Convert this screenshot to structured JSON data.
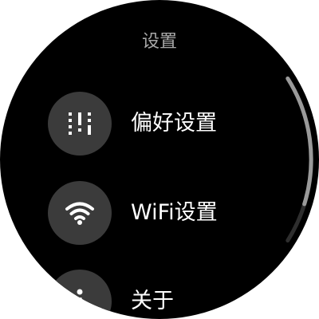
{
  "screen": {
    "title": "设置"
  },
  "menu": {
    "items": [
      {
        "label": "偏好设置",
        "icon": "preferences-icon"
      },
      {
        "label": "WiFi设置",
        "icon": "wifi-icon"
      },
      {
        "label": "关于",
        "icon": "info-icon"
      }
    ]
  },
  "colors": {
    "background": "#000000",
    "icon_circle": "#3b3b3b",
    "title": "#a8a8a8",
    "label": "#ffffff",
    "scrollbar_track": "#2e2e2e",
    "scrollbar_thumb": "#9a9a9a"
  }
}
